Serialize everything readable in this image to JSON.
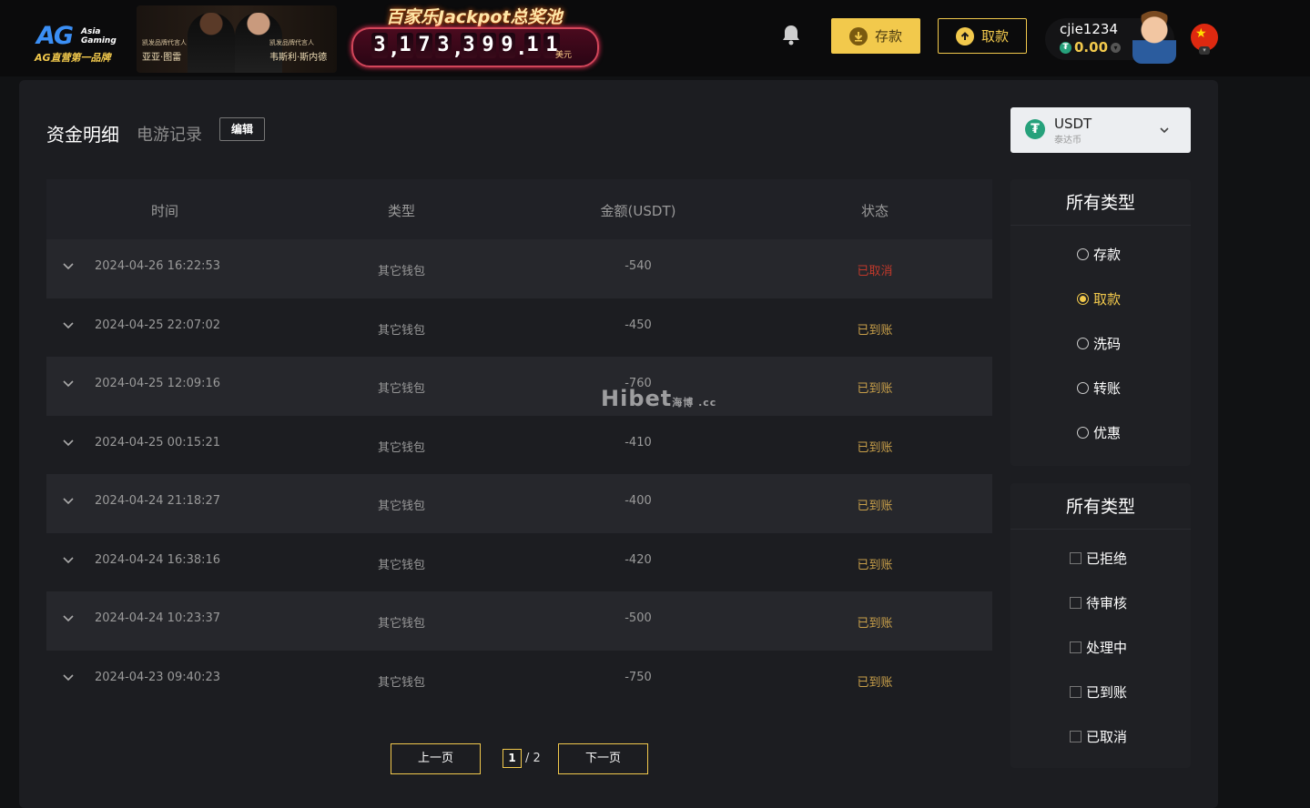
{
  "header": {
    "logo": {
      "brand": "AG",
      "sub": "Asia Gaming",
      "slogan": "AG直营第一品牌"
    },
    "ambassadors": [
      {
        "label": "凯发品牌代言人",
        "name": "亚亚·图雷"
      },
      {
        "label": "凯发品牌代言人",
        "name": "韦斯利·斯内德"
      }
    ],
    "jackpot": {
      "title": "百家乐Jackpot总奖池",
      "amount": "3,173,399.11",
      "unit": "美元"
    },
    "deposit_label": "存款",
    "withdraw_label": "取款",
    "user": {
      "username": "cjie1234",
      "balance": "0.00"
    }
  },
  "tabs": {
    "active": "资金明细",
    "other": "电游记录",
    "edit": "编辑"
  },
  "table": {
    "headers": [
      "时间",
      "类型",
      "金额(USDT)",
      "状态"
    ],
    "rows": [
      {
        "time": "2024-04-26 16:22:53",
        "type": "其它钱包",
        "amount": "-540",
        "status": "已取消"
      },
      {
        "time": "2024-04-25 22:07:02",
        "type": "其它钱包",
        "amount": "-450",
        "status": "已到账"
      },
      {
        "time": "2024-04-25 12:09:16",
        "type": "其它钱包",
        "amount": "-760",
        "status": "已到账"
      },
      {
        "time": "2024-04-25 00:15:21",
        "type": "其它钱包",
        "amount": "-410",
        "status": "已到账"
      },
      {
        "time": "2024-04-24 21:18:27",
        "type": "其它钱包",
        "amount": "-400",
        "status": "已到账"
      },
      {
        "time": "2024-04-24 16:38:16",
        "type": "其它钱包",
        "amount": "-420",
        "status": "已到账"
      },
      {
        "time": "2024-04-24 10:23:37",
        "type": "其它钱包",
        "amount": "-500",
        "status": "已到账"
      },
      {
        "time": "2024-04-23 09:40:23",
        "type": "其它钱包",
        "amount": "-750",
        "status": "已到账"
      }
    ]
  },
  "watermark": {
    "text": "Hibet",
    "suffix": "海博 .cc"
  },
  "pagination": {
    "prev": "上一页",
    "next": "下一页",
    "current": "1",
    "total": "/ 2"
  },
  "currency": {
    "name": "USDT",
    "sub": "泰达币"
  },
  "filters": {
    "type": {
      "title": "所有类型",
      "options": [
        "存款",
        "取款",
        "洗码",
        "转账",
        "优惠"
      ],
      "selected": "取款"
    },
    "status": {
      "title": "所有类型",
      "options": [
        "已拒绝",
        "待审核",
        "处理中",
        "已到账",
        "已取消"
      ]
    }
  },
  "colors": {
    "accent": "#f2c94c",
    "status_cancelled": "#c0392b",
    "status_done": "#c9a04a",
    "panel": "#1c1d21",
    "row_alt": "#26272c"
  }
}
